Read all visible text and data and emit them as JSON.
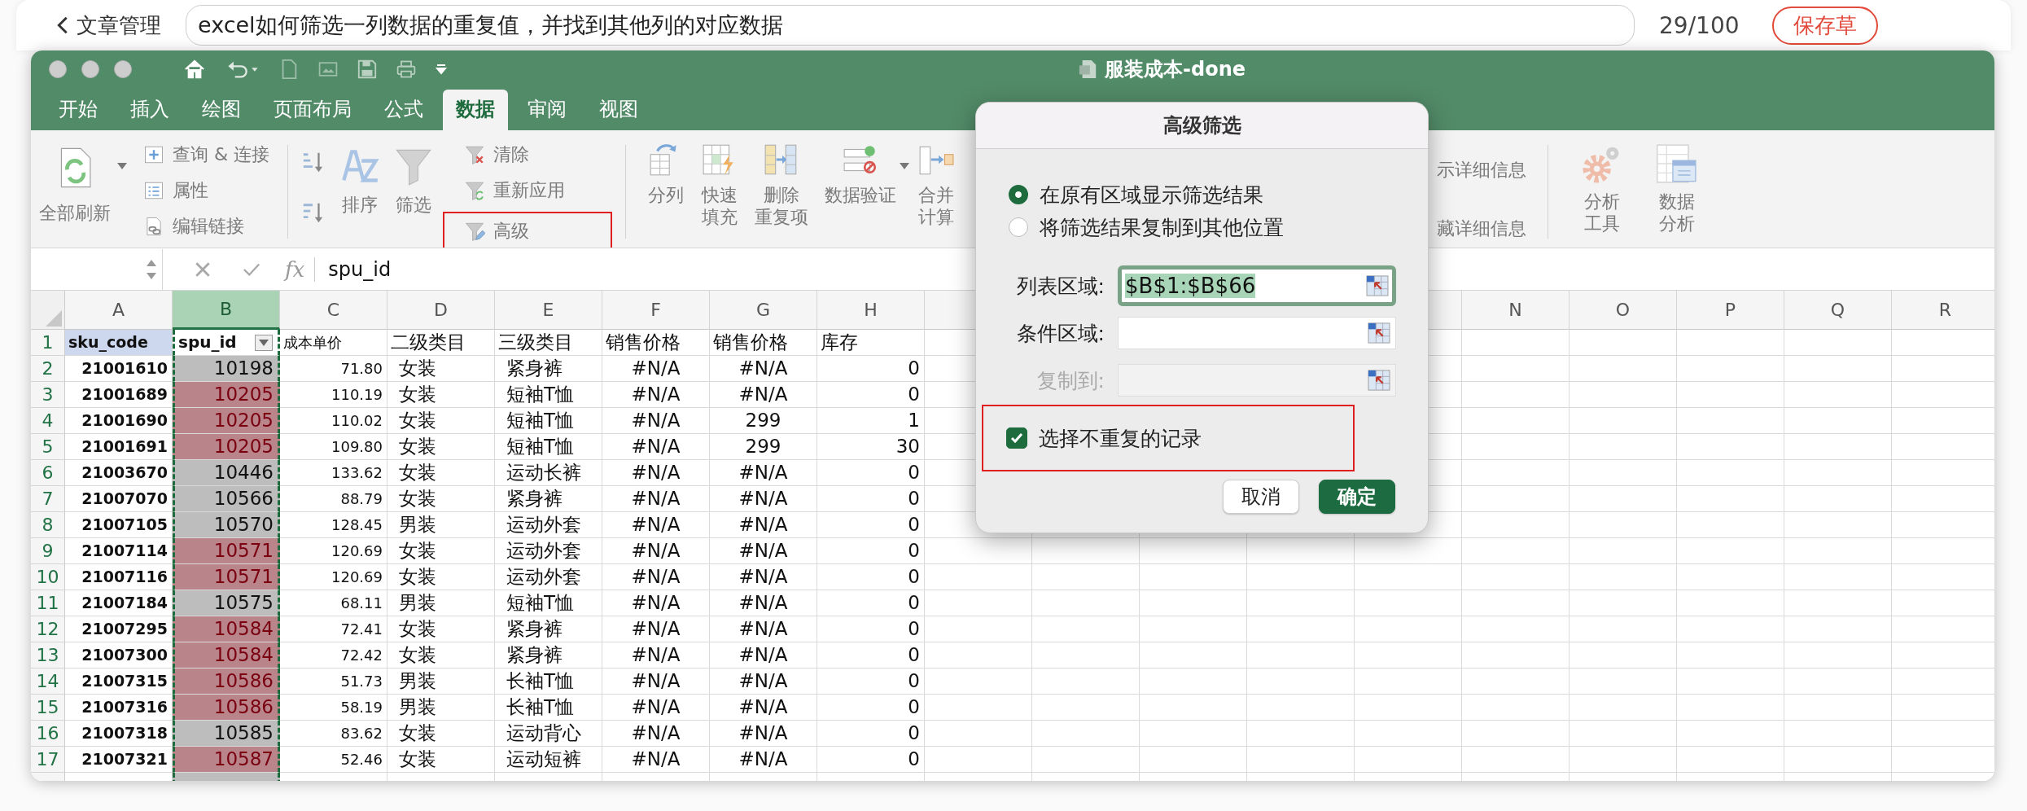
{
  "backdrop": {
    "back_link": "文章管理",
    "article_title": "excel如何筛选一列数据的重复值，并找到其他列的对应数据",
    "word_count": "29/100",
    "save_button": "保存草"
  },
  "window": {
    "title": "服装成本-done"
  },
  "tabs": [
    {
      "label": "开始",
      "selected": false
    },
    {
      "label": "插入",
      "selected": false
    },
    {
      "label": "绘图",
      "selected": false
    },
    {
      "label": "页面布局",
      "selected": false
    },
    {
      "label": "公式",
      "selected": false
    },
    {
      "label": "数据",
      "selected": true
    },
    {
      "label": "审阅",
      "selected": false
    },
    {
      "label": "视图",
      "selected": false
    }
  ],
  "ribbon": {
    "refresh": "全部刷新",
    "connections": [
      "查询 & 连接",
      "属性",
      "编辑链接"
    ],
    "sort": "排序",
    "filter": "筛选",
    "filter_actions": [
      {
        "label": "清除",
        "highlighted": false
      },
      {
        "label": "重新应用",
        "highlighted": false
      },
      {
        "label": "高级",
        "highlighted": true
      }
    ],
    "tools": [
      {
        "lines": [
          "分列"
        ]
      },
      {
        "lines": [
          "快速",
          "填充"
        ]
      },
      {
        "lines": [
          "删除",
          "重复项"
        ]
      },
      {
        "lines": [
          "数据验证"
        ]
      },
      {
        "lines": [
          "合并",
          "计算"
        ]
      }
    ],
    "details": [
      "示详细信息",
      "藏详细信息"
    ],
    "analysis": [
      {
        "lines": [
          "分析",
          "工具"
        ]
      },
      {
        "lines": [
          "数据",
          "分析"
        ]
      }
    ]
  },
  "formula_bar": {
    "function_button": "fx",
    "formula": "spu_id"
  },
  "sheet": {
    "columns": [
      {
        "label": "A",
        "selected": false
      },
      {
        "label": "B",
        "selected": true
      },
      {
        "label": "C",
        "selected": false
      },
      {
        "label": "D",
        "selected": false
      },
      {
        "label": "E",
        "selected": false
      },
      {
        "label": "F",
        "selected": false
      },
      {
        "label": "G",
        "selected": false
      },
      {
        "label": "H",
        "selected": false
      }
    ],
    "far_columns": [
      {
        "label": "N",
        "selected": false
      },
      {
        "label": "O",
        "selected": false
      },
      {
        "label": "P",
        "selected": false
      },
      {
        "label": "Q",
        "selected": false
      },
      {
        "label": "R",
        "selected": false
      }
    ],
    "header_row": {
      "number": "1",
      "cells": [
        "sku_code",
        "spu_id",
        "成本单价",
        "二级类目",
        "三级类目",
        "销售价格",
        "销售价格",
        "库存"
      ]
    },
    "rows": [
      {
        "number": "2",
        "duplicate": false,
        "cells": [
          "21001610",
          "10198",
          "71.80",
          "女装",
          "紧身裤",
          "#N/A",
          "#N/A",
          "0"
        ]
      },
      {
        "number": "3",
        "duplicate": true,
        "cells": [
          "21001689",
          "10205",
          "110.19",
          "女装",
          "短袖T恤",
          "#N/A",
          "#N/A",
          "0"
        ]
      },
      {
        "number": "4",
        "duplicate": true,
        "cells": [
          "21001690",
          "10205",
          "110.02",
          "女装",
          "短袖T恤",
          "#N/A",
          "299",
          "1"
        ]
      },
      {
        "number": "5",
        "duplicate": true,
        "cells": [
          "21001691",
          "10205",
          "109.80",
          "女装",
          "短袖T恤",
          "#N/A",
          "299",
          "30"
        ]
      },
      {
        "number": "6",
        "duplicate": false,
        "cells": [
          "21003670",
          "10446",
          "133.62",
          "女装",
          "运动长裤",
          "#N/A",
          "#N/A",
          "0"
        ]
      },
      {
        "number": "7",
        "duplicate": false,
        "cells": [
          "21007070",
          "10566",
          "88.79",
          "女装",
          "紧身裤",
          "#N/A",
          "#N/A",
          "0"
        ]
      },
      {
        "number": "8",
        "duplicate": false,
        "cells": [
          "21007105",
          "10570",
          "128.45",
          "男装",
          "运动外套",
          "#N/A",
          "#N/A",
          "0"
        ]
      },
      {
        "number": "9",
        "duplicate": true,
        "cells": [
          "21007114",
          "10571",
          "120.69",
          "女装",
          "运动外套",
          "#N/A",
          "#N/A",
          "0"
        ]
      },
      {
        "number": "10",
        "duplicate": true,
        "cells": [
          "21007116",
          "10571",
          "120.69",
          "女装",
          "运动外套",
          "#N/A",
          "#N/A",
          "0"
        ]
      },
      {
        "number": "11",
        "duplicate": false,
        "cells": [
          "21007184",
          "10575",
          "68.11",
          "男装",
          "短袖T恤",
          "#N/A",
          "#N/A",
          "0"
        ]
      },
      {
        "number": "12",
        "duplicate": true,
        "cells": [
          "21007295",
          "10584",
          "72.41",
          "女装",
          "紧身裤",
          "#N/A",
          "#N/A",
          "0"
        ]
      },
      {
        "number": "13",
        "duplicate": true,
        "cells": [
          "21007300",
          "10584",
          "72.42",
          "女装",
          "紧身裤",
          "#N/A",
          "#N/A",
          "0"
        ]
      },
      {
        "number": "14",
        "duplicate": true,
        "cells": [
          "21007315",
          "10586",
          "51.73",
          "男装",
          "长袖T恤",
          "#N/A",
          "#N/A",
          "0"
        ]
      },
      {
        "number": "15",
        "duplicate": true,
        "cells": [
          "21007316",
          "10586",
          "58.19",
          "男装",
          "长袖T恤",
          "#N/A",
          "#N/A",
          "0"
        ]
      },
      {
        "number": "16",
        "duplicate": false,
        "cells": [
          "21007318",
          "10585",
          "83.62",
          "女装",
          "运动背心",
          "#N/A",
          "#N/A",
          "0"
        ]
      },
      {
        "number": "17",
        "duplicate": true,
        "cells": [
          "21007321",
          "10587",
          "52.46",
          "女装",
          "运动短裤",
          "#N/A",
          "#N/A",
          "0"
        ]
      }
    ]
  },
  "dialog": {
    "title": "高级筛选",
    "actions": [
      {
        "label": "在原有区域显示筛选结果",
        "selected": true
      },
      {
        "label": "将筛选结果复制到其他位置",
        "selected": false
      }
    ],
    "fields": [
      {
        "label": "列表区域:",
        "value": "$B$1:$B$66",
        "focused": true,
        "disabled": false
      },
      {
        "label": "条件区域:",
        "focused": false,
        "disabled": false
      },
      {
        "label": "复制到:",
        "focused": false,
        "disabled": true
      }
    ],
    "unique_only": {
      "label": "选择不重复的记录",
      "checked": true,
      "highlighted": true
    },
    "buttons": [
      {
        "label": "取消",
        "primary": false
      },
      {
        "label": "确定",
        "primary": true
      }
    ]
  }
}
